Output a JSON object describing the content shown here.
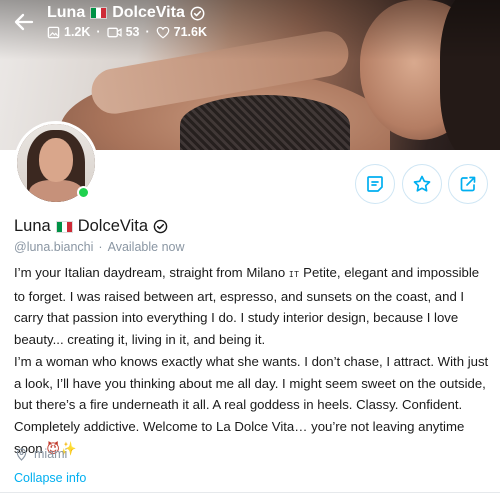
{
  "header": {
    "name": "Luna",
    "flag_name": "italy-flag",
    "name_suffix": "DolceVita",
    "stats": {
      "photos": "1.2K",
      "videos": "53",
      "likes": "71.6K"
    }
  },
  "profile": {
    "display_name": "Luna",
    "display_suffix": "DolceVita",
    "handle": "@luna.bianchi",
    "separator": "·",
    "availability": "Available now",
    "location": "miami",
    "collapse_label": "Collapse info"
  },
  "bio": {
    "line_1": "I’m your Italian daydream, straight from Milano",
    "it_badge": "IT",
    "line_1_cont": "Petite, elegant and impossible to forget. I was raised between art, espresso, and sunsets on the coast, and I carry that passion into everything I do. I study interior design, because I love beauty... creating it, living in it, and being it.",
    "paragraph_2": "I’m a woman who knows exactly what she wants. I don’t chase, I attract. With just a look, I’ll have you thinking about me all day. I might seem sweet on the outside, but there’s a fire underneath it all. A real goddess in heels. Classy. Confident. Completely addictive. Welcome to La Dolce Vita… you’re not leaving anytime soon",
    "emojis": "😈✨"
  },
  "colors": {
    "accent": "#00aff0",
    "muted": "#8a96a3",
    "online": "#1fd14e",
    "flag_green": "#009246",
    "flag_white": "#ffffff",
    "flag_red": "#ce2b37"
  },
  "icons": [
    "back-arrow-icon",
    "verified-icon",
    "photo-icon",
    "video-icon",
    "heart-icon",
    "message-icon",
    "star-icon",
    "share-icon",
    "location-pin-icon"
  ]
}
